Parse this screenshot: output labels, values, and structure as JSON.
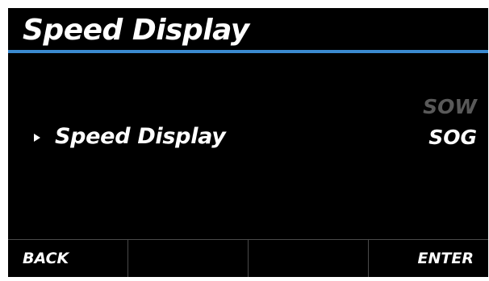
{
  "screen": {
    "title": "Speed Display"
  },
  "menu": {
    "selected_item": {
      "label": "Speed Display",
      "pointer_icon": "triangle-right-icon"
    },
    "options": [
      {
        "label": "SOW",
        "active": false
      },
      {
        "label": "SOG",
        "active": true
      }
    ]
  },
  "softkeys": {
    "back": "BACK",
    "key2": "",
    "key3": "",
    "enter": "ENTER"
  },
  "colors": {
    "background": "#000000",
    "accent_rule": "#3b8ad0",
    "text": "#ffffff",
    "inactive_option": "#595959",
    "divider": "#4a4a4a"
  }
}
